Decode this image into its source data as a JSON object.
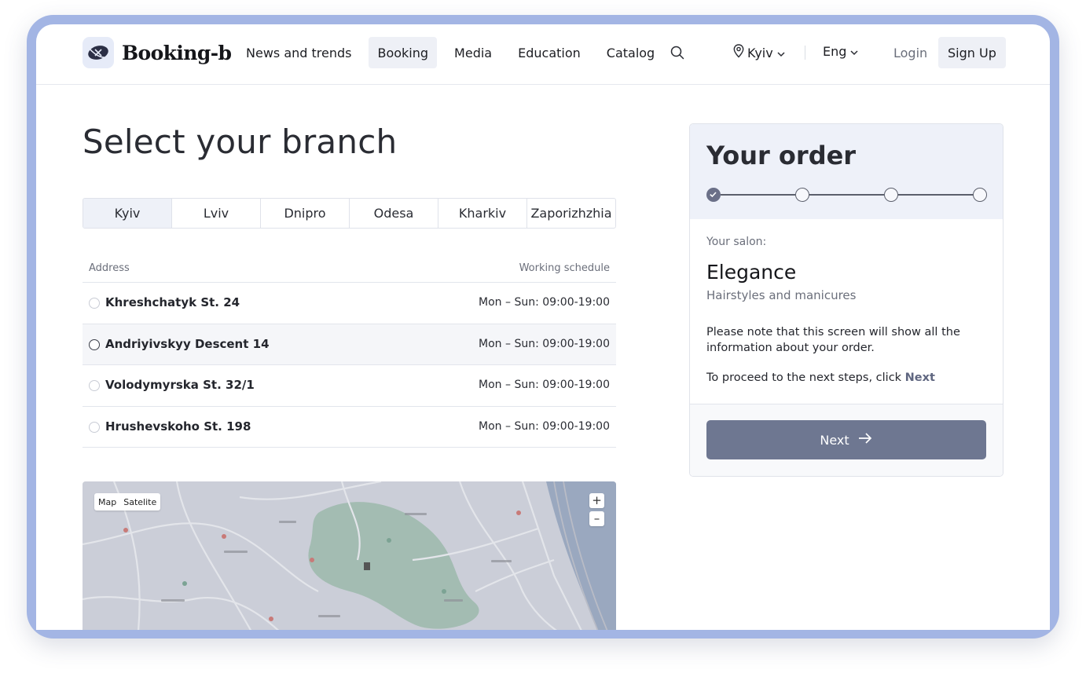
{
  "brand": {
    "name": "Booking-b"
  },
  "nav": {
    "items": [
      {
        "label": "News and trends",
        "active": false
      },
      {
        "label": "Booking",
        "active": true
      },
      {
        "label": "Media",
        "active": false
      },
      {
        "label": "Education",
        "active": false
      },
      {
        "label": "Catalog",
        "active": false
      }
    ],
    "search_icon": "search-icon"
  },
  "header": {
    "city": "Kyiv",
    "language": "Eng",
    "login_label": "Login",
    "signup_label": "Sign Up"
  },
  "page": {
    "title": "Select your branch",
    "city_tabs": [
      {
        "label": "Kyiv",
        "active": true
      },
      {
        "label": "Lviv",
        "active": false
      },
      {
        "label": "Dnipro",
        "active": false
      },
      {
        "label": "Odesa",
        "active": false
      },
      {
        "label": "Kharkiv",
        "active": false
      },
      {
        "label": "Zaporizhzhia",
        "active": false
      }
    ],
    "table": {
      "col_address": "Address",
      "col_schedule": "Working schedule",
      "rows": [
        {
          "address": "Khreshchatyk St. 24",
          "schedule": "Mon – Sun: 09:00-19:00"
        },
        {
          "address": "Andriyivskyy Descent 14",
          "schedule": "Mon – Sun: 09:00-19:00"
        },
        {
          "address": "Volodymyrska St. 32/1",
          "schedule": "Mon – Sun: 09:00-19:00"
        },
        {
          "address": "Hrushevskoho St. 198",
          "schedule": "Mon – Sun: 09:00-19:00"
        }
      ]
    },
    "map": {
      "type_map": "Map",
      "type_satellite": "Satelite",
      "zoom_in": "+",
      "zoom_out": "–"
    }
  },
  "order": {
    "title": "Your order",
    "steps_total": 4,
    "steps_completed": 1,
    "salon_label": "Your salon:",
    "salon_name": "Elegance",
    "salon_desc": "Hairstyles and manicures",
    "note": "Please note that this screen will show all the information about your order.",
    "proceed_text": "To proceed to the next steps, click",
    "proceed_next": "Next",
    "next_button": "Next"
  },
  "colors": {
    "frame": "#a3b5e4",
    "accent": "#6e7791",
    "active_bg": "#eef0f6"
  }
}
